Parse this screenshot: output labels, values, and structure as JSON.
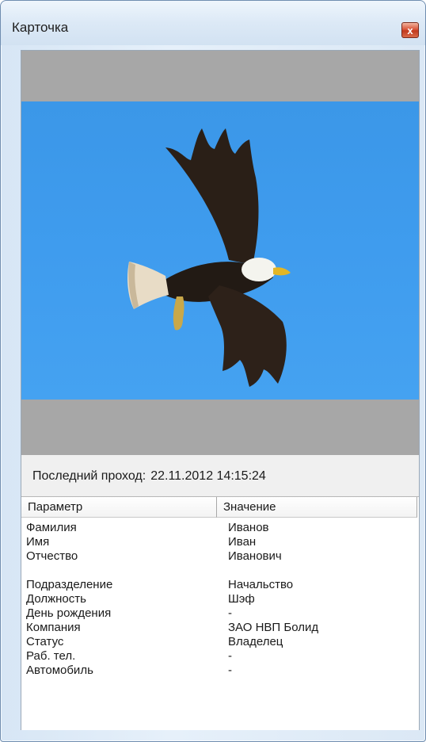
{
  "window": {
    "title": "Карточка",
    "close_glyph": "x"
  },
  "colors": {
    "sky": "#3f9cee",
    "photo_frame": "#a7a7a7",
    "close_button": "#d9553a"
  },
  "last_pass": {
    "label": "Последний проход:",
    "value": "22.11.2012 14:15:24"
  },
  "table": {
    "columns": [
      "Параметр",
      "Значение"
    ],
    "rows": [
      {
        "param": "Фамилия",
        "value": "Иванов"
      },
      {
        "param": "Имя",
        "value": "Иван"
      },
      {
        "param": "Отчество",
        "value": "Иванович"
      },
      {
        "param": "",
        "value": ""
      },
      {
        "param": "Подразделение",
        "value": "Начальство"
      },
      {
        "param": "Должность",
        "value": "Шэф"
      },
      {
        "param": "День рождения",
        "value": "-"
      },
      {
        "param": "Компания",
        "value": "ЗАО НВП Болид"
      },
      {
        "param": "Статус",
        "value": "Владелец"
      },
      {
        "param": "Раб. тел.",
        "value": "-"
      },
      {
        "param": "Автомобиль",
        "value": "-"
      }
    ]
  }
}
